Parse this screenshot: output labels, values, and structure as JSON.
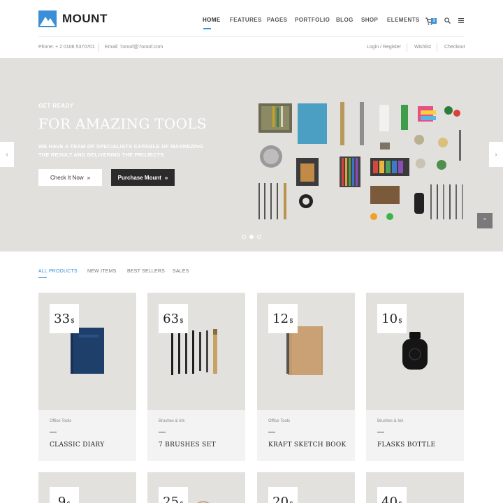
{
  "brand": {
    "name": "MOUNT",
    "accent": "#3b8fd9"
  },
  "nav": {
    "items": [
      "HOME",
      "FEATURES",
      "PAGES",
      "PORTFOLIO",
      "BLOG",
      "SHOP",
      "ELEMENTS"
    ],
    "active": "HOME",
    "cart_count": "3"
  },
  "info_bar": {
    "phone": "Phone: + 2 0106 5370701",
    "email": "Email: 7oroof@7oroof.com",
    "login": "Login / Register",
    "wishlist": "Wishlist",
    "checkout": "Checkout"
  },
  "hero": {
    "kicker": "GET READY",
    "title": "FOR AMAZING TOOLS",
    "description": "WE HAVE A TEAM OF SPECIALISTS CAPABLE OF MAXIMIZING THE RESULT AND DELIVERING THE PROJECTS",
    "primary_button": "Check It Now",
    "secondary_button": "Purchase Mount",
    "slides": 3,
    "active_slide": 2,
    "background": "#e1e0dc"
  },
  "products": {
    "tabs": [
      "ALL PRODUCTS",
      "NEW ITEMS",
      "BEST SELLERS",
      "SALES"
    ],
    "active_tab": "ALL PRODUCTS",
    "currency": "$",
    "items": [
      {
        "price": "33",
        "category": "Office Tools",
        "name": "CLASSIC DIARY",
        "image": "navy-notebook"
      },
      {
        "price": "63",
        "category": "Brushes & Ink",
        "name": "7 BRUSHES SET",
        "image": "brushes"
      },
      {
        "price": "12",
        "category": "Office Tools",
        "name": "KRAFT SKETCH BOOK",
        "image": "kraft-notebook"
      },
      {
        "price": "10",
        "category": "Brushes & Ink",
        "name": "FLASKS BOTTLE",
        "image": "ink-bottle"
      }
    ],
    "more_prices": [
      "9",
      "25",
      "20",
      "40"
    ]
  }
}
